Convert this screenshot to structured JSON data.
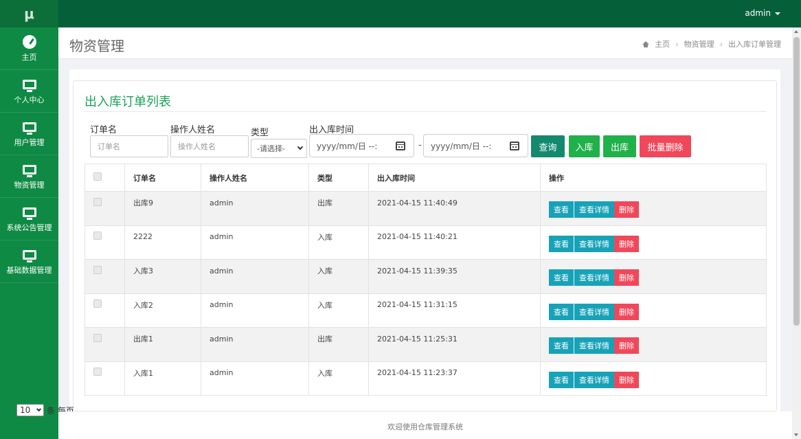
{
  "logo": "μ",
  "sidebar": {
    "items": [
      {
        "label": "主页",
        "icon": "dashboard-icon"
      },
      {
        "label": "个人中心",
        "icon": "monitor-icon"
      },
      {
        "label": "用户管理",
        "icon": "monitor-icon"
      },
      {
        "label": "物资管理",
        "icon": "monitor-icon"
      },
      {
        "label": "系统公告管理",
        "icon": "monitor-icon"
      },
      {
        "label": "基础数据管理",
        "icon": "monitor-icon"
      }
    ]
  },
  "topbar": {
    "user": "admin"
  },
  "header": {
    "title": "物资管理",
    "breadcrumb": [
      "主页",
      "物资管理",
      "出入库订单管理"
    ]
  },
  "list": {
    "title": "出入库订单列表",
    "filters": {
      "order_name_label": "订单名",
      "order_name_placeholder": "订单名",
      "operator_label": "操作人姓名",
      "operator_placeholder": "操作人姓名",
      "type_label": "类型",
      "type_selected": "-请选择-",
      "time_label": "出入库时间",
      "date_start_placeholder": "yyyy/mm/日 --:",
      "date_end_placeholder": "yyyy/mm/日 --:",
      "range_sep": "-"
    },
    "buttons": {
      "query": "查询",
      "stock_in": "入库",
      "stock_out": "出库",
      "batch_delete": "批量删除"
    },
    "columns": [
      "订单名",
      "操作人姓名",
      "类型",
      "出入库时间",
      "操作"
    ],
    "rows": [
      {
        "name": "出库9",
        "operator": "admin",
        "type": "出库",
        "time": "2021-04-15 11:40:49"
      },
      {
        "name": "2222",
        "operator": "admin",
        "type": "入库",
        "time": "2021-04-15 11:40:21"
      },
      {
        "name": "入库3",
        "operator": "admin",
        "type": "入库",
        "time": "2021-04-15 11:39:35"
      },
      {
        "name": "入库2",
        "operator": "admin",
        "type": "入库",
        "time": "2021-04-15 11:31:15"
      },
      {
        "name": "出库1",
        "operator": "admin",
        "type": "出库",
        "time": "2021-04-15 11:25:31"
      },
      {
        "name": "入库1",
        "operator": "admin",
        "type": "入库",
        "time": "2021-04-15 11:23:37"
      }
    ],
    "row_actions": {
      "view": "查看",
      "detail": "查看详情",
      "delete": "删除"
    },
    "pager": {
      "page_size": "10",
      "suffix": "条 每页"
    }
  },
  "footer": {
    "text": "欢迎使用仓库管理系统"
  }
}
